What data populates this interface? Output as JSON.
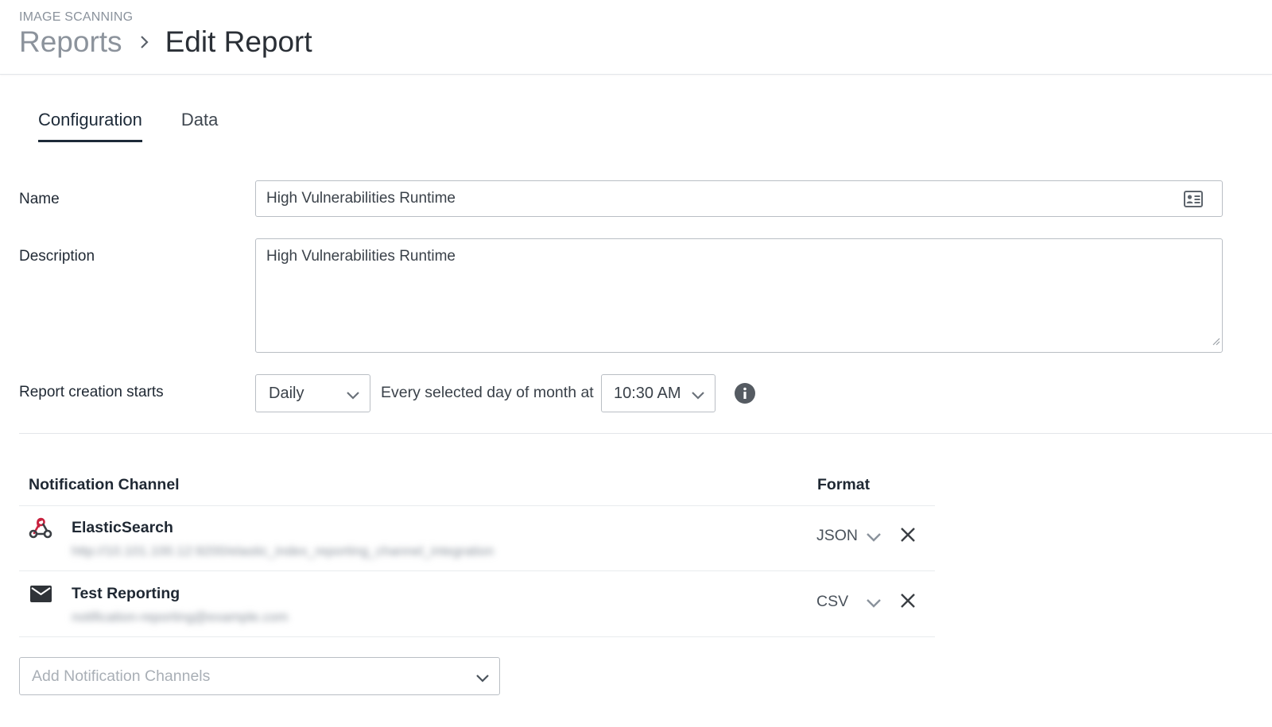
{
  "header": {
    "eyebrow": "IMAGE SCANNING",
    "breadcrumb_parent": "Reports",
    "breadcrumb_current": "Edit Report"
  },
  "tabs": [
    {
      "label": "Configuration",
      "active": true
    },
    {
      "label": "Data",
      "active": false
    }
  ],
  "form": {
    "name_label": "Name",
    "name_value": "High Vulnerabilities Runtime",
    "description_label": "Description",
    "description_value": "High Vulnerabilities Runtime",
    "schedule_label": "Report creation starts",
    "frequency_value": "Daily",
    "schedule_text": "Every selected day of month at",
    "time_value": "10:30 AM"
  },
  "notifications": {
    "col_channel": "Notification Channel",
    "col_format": "Format",
    "rows": [
      {
        "icon": "webhook-icon",
        "name": "ElasticSearch",
        "detail": "http://10.101.100.12:9200/elastic_index_reporting_channel_integration",
        "format": "JSON"
      },
      {
        "icon": "envelope-icon",
        "name": "Test Reporting",
        "detail": "notification-reporting@example.com",
        "format": "CSV"
      }
    ],
    "add_placeholder": "Add Notification Channels"
  },
  "colors": {
    "accent": "#1d2a38",
    "border": "#b9bec4",
    "webhook": "#c8223f",
    "muted_text": "#8a929c"
  }
}
